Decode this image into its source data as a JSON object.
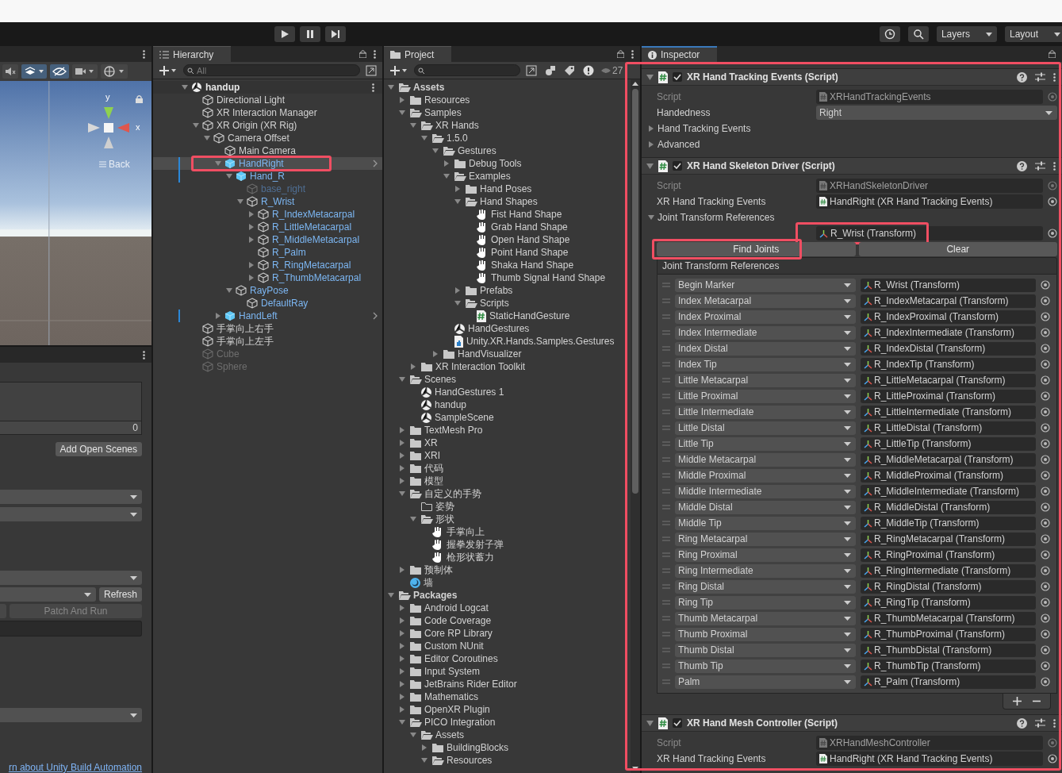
{
  "toolbar": {
    "layers": "Layers",
    "layout": "Layout"
  },
  "scene_view": {
    "y_label": "y",
    "x_label": "x",
    "back_label": "Back"
  },
  "build_panel": {
    "scene_count": "0",
    "add_button": "Add Open Scenes",
    "refresh_button": "Refresh",
    "patch_button": {
      "label": "Patch And Run",
      "disabled": true
    },
    "link": "rn about Unity Build Automation"
  },
  "hierarchy": {
    "title": "Hierarchy",
    "search_placeholder": "All",
    "items": [
      {
        "name": "handup",
        "kind": "scene",
        "selected": false,
        "expanded": true,
        "children": [
          {
            "name": "Directional Light",
            "kind": "object",
            "selected": false
          },
          {
            "name": "XR Interaction Manager",
            "kind": "object",
            "selected": false
          },
          {
            "name": "XR Origin (XR Rig)",
            "kind": "object",
            "selected": false,
            "expanded": true,
            "children": [
              {
                "name": "Camera Offset",
                "kind": "object",
                "selected": false,
                "expanded": true,
                "children": [
                  {
                    "name": "Main Camera",
                    "kind": "object",
                    "selected": false
                  },
                  {
                    "name": "HandRight",
                    "kind": "prefab_root",
                    "selected": true,
                    "highlighted": true,
                    "expanded": true,
                    "children": [
                      {
                        "name": "Hand_R",
                        "kind": "prefab_root",
                        "selected": false,
                        "expanded": true,
                        "children": [
                          {
                            "name": "base_right",
                            "kind": "inactive_prefab",
                            "selected": false
                          },
                          {
                            "name": "R_Wrist",
                            "kind": "prefab",
                            "selected": false,
                            "expanded": true,
                            "children": [
                              {
                                "name": "R_IndexMetacarpal",
                                "kind": "prefab",
                                "selected": false,
                                "expanded": false
                              },
                              {
                                "name": "R_LittleMetacarpal",
                                "kind": "prefab",
                                "selected": false,
                                "expanded": false
                              },
                              {
                                "name": "R_MiddleMetacarpal",
                                "kind": "prefab",
                                "selected": false,
                                "expanded": false
                              },
                              {
                                "name": "R_Palm",
                                "kind": "prefab",
                                "selected": false
                              },
                              {
                                "name": "R_RingMetacarpal",
                                "kind": "prefab",
                                "selected": false,
                                "expanded": false
                              },
                              {
                                "name": "R_ThumbMetacarpal",
                                "kind": "prefab",
                                "selected": false,
                                "expanded": false
                              }
                            ]
                          }
                        ]
                      },
                      {
                        "name": "RayPose",
                        "kind": "prefab",
                        "selected": false,
                        "expanded": true,
                        "children": [
                          {
                            "name": "DefaultRay",
                            "kind": "prefab",
                            "selected": false
                          }
                        ]
                      }
                    ]
                  },
                  {
                    "name": "HandLeft",
                    "kind": "prefab_root",
                    "selected": false,
                    "expanded": false
                  }
                ]
              }
            ]
          },
          {
            "name": "手掌向上右手",
            "kind": "object",
            "selected": false
          },
          {
            "name": "手掌向上左手",
            "kind": "object",
            "selected": false
          },
          {
            "name": "Cube",
            "kind": "inactive_object",
            "selected": false
          },
          {
            "name": "Sphere",
            "kind": "inactive_object",
            "selected": false
          }
        ]
      }
    ]
  },
  "project": {
    "title": "Project",
    "hidden_count": "27",
    "items": [
      {
        "name": "Assets",
        "kind": "root",
        "expanded": true,
        "children": [
          {
            "name": "Resources",
            "kind": "folder",
            "expanded": false
          },
          {
            "name": "Samples",
            "kind": "folder",
            "expanded": true,
            "children": [
              {
                "name": "XR Hands",
                "kind": "folder",
                "expanded": true,
                "children": [
                  {
                    "name": "1.5.0",
                    "kind": "folder",
                    "expanded": true,
                    "children": [
                      {
                        "name": "Gestures",
                        "kind": "folder",
                        "expanded": true,
                        "children": [
                          {
                            "name": "Debug Tools",
                            "kind": "folder",
                            "expanded": false
                          },
                          {
                            "name": "Examples",
                            "kind": "folder",
                            "expanded": true,
                            "children": [
                              {
                                "name": "Hand Poses",
                                "kind": "folder",
                                "expanded": false
                              },
                              {
                                "name": "Hand Shapes",
                                "kind": "folder",
                                "expanded": true,
                                "children": [
                                  {
                                    "name": "Fist Hand Shape",
                                    "kind": "hand_shape"
                                  },
                                  {
                                    "name": "Grab Hand Shape",
                                    "kind": "hand_shape"
                                  },
                                  {
                                    "name": "Open Hand Shape",
                                    "kind": "hand_shape"
                                  },
                                  {
                                    "name": "Point Hand Shape",
                                    "kind": "hand_shape"
                                  },
                                  {
                                    "name": "Shaka Hand Shape",
                                    "kind": "hand_shape"
                                  },
                                  {
                                    "name": "Thumb Signal Hand Shape",
                                    "kind": "hand_shape"
                                  }
                                ]
                              },
                              {
                                "name": "Prefabs",
                                "kind": "folder",
                                "expanded": false
                              },
                              {
                                "name": "Scripts",
                                "kind": "folder",
                                "expanded": true,
                                "children": [
                                  {
                                    "name": "StaticHandGesture",
                                    "kind": "script"
                                  }
                                ]
                              }
                            ]
                          },
                          {
                            "name": "HandGestures",
                            "kind": "scene"
                          },
                          {
                            "name": "Unity.XR.Hands.Samples.Gestures",
                            "kind": "assembly"
                          }
                        ]
                      },
                      {
                        "name": "HandVisualizer",
                        "kind": "folder",
                        "expanded": false
                      }
                    ]
                  }
                ]
              },
              {
                "name": "XR Interaction Toolkit",
                "kind": "folder",
                "expanded": false
              }
            ]
          },
          {
            "name": "Scenes",
            "kind": "folder",
            "expanded": true,
            "children": [
              {
                "name": "HandGestures 1",
                "kind": "scene"
              },
              {
                "name": "handup",
                "kind": "scene"
              },
              {
                "name": "SampleScene",
                "kind": "scene"
              }
            ]
          },
          {
            "name": "TextMesh Pro",
            "kind": "folder",
            "expanded": false
          },
          {
            "name": "XR",
            "kind": "folder",
            "expanded": false
          },
          {
            "name": "XRI",
            "kind": "folder",
            "expanded": false
          },
          {
            "name": "代码",
            "kind": "folder",
            "expanded": false
          },
          {
            "name": "模型",
            "kind": "folder",
            "expanded": false
          },
          {
            "name": "自定义的手势",
            "kind": "folder",
            "expanded": true,
            "children": [
              {
                "name": "姿势",
                "kind": "empty_folder"
              },
              {
                "name": "形状",
                "kind": "folder",
                "expanded": true,
                "children": [
                  {
                    "name": "手掌向上",
                    "kind": "hand_shape"
                  },
                  {
                    "name": "握拳发射子弹",
                    "kind": "hand_shape"
                  },
                  {
                    "name": "枪形状蓄力",
                    "kind": "hand_shape"
                  }
                ]
              }
            ]
          },
          {
            "name": "预制体",
            "kind": "folder",
            "expanded": false
          },
          {
            "name": "墙",
            "kind": "material"
          }
        ]
      },
      {
        "name": "Packages",
        "kind": "root",
        "expanded": true,
        "children": [
          {
            "name": "Android Logcat",
            "kind": "folder",
            "expanded": false
          },
          {
            "name": "Code Coverage",
            "kind": "folder",
            "expanded": false
          },
          {
            "name": "Core RP Library",
            "kind": "folder",
            "expanded": false
          },
          {
            "name": "Custom NUnit",
            "kind": "folder",
            "expanded": false
          },
          {
            "name": "Editor Coroutines",
            "kind": "folder",
            "expanded": false
          },
          {
            "name": "Input System",
            "kind": "folder",
            "expanded": false
          },
          {
            "name": "JetBrains Rider Editor",
            "kind": "folder",
            "expanded": false
          },
          {
            "name": "Mathematics",
            "kind": "folder",
            "expanded": false
          },
          {
            "name": "OpenXR Plugin",
            "kind": "folder",
            "expanded": false
          },
          {
            "name": "PICO Integration",
            "kind": "folder",
            "expanded": true,
            "children": [
              {
                "name": "Assets",
                "kind": "folder",
                "expanded": true,
                "children": [
                  {
                    "name": "BuildingBlocks",
                    "kind": "folder",
                    "expanded": false
                  },
                  {
                    "name": "Resources",
                    "kind": "folder",
                    "expanded": true
                  }
                ]
              }
            ]
          }
        ]
      }
    ]
  },
  "inspector": {
    "title": "Inspector",
    "highlighted": true,
    "components": [
      {
        "title": "XR Hand Tracking Events (Script)",
        "enabled": true,
        "expanded": true,
        "fields": [
          {
            "kind": "script",
            "label": "Script",
            "value": "XRHandTrackingEvents"
          },
          {
            "kind": "dropdown",
            "label": "Handedness",
            "value": "Right"
          },
          {
            "kind": "foldout",
            "label": "Hand Tracking Events",
            "expanded": false
          },
          {
            "kind": "foldout",
            "label": "Advanced",
            "expanded": false
          }
        ]
      },
      {
        "title": "XR Hand Skeleton Driver (Script)",
        "enabled": true,
        "expanded": true,
        "fields": [
          {
            "kind": "script",
            "label": "Script",
            "value": "XRHandSkeletonDriver"
          },
          {
            "kind": "object",
            "label": "XR Hand Tracking Events",
            "value": "HandRight (XR Hand Tracking Events)"
          },
          {
            "kind": "foldout",
            "label": "Joint Transform References",
            "expanded": true
          },
          {
            "kind": "transform",
            "value": "R_Wrist (Transform)",
            "highlighted": true
          },
          {
            "kind": "buttons",
            "buttons": [
              {
                "label": "Find Joints",
                "highlighted": true
              },
              {
                "label": "Clear"
              }
            ]
          },
          {
            "kind": "joint_list",
            "header": "Joint Transform References",
            "rows": [
              {
                "joint": "Begin Marker",
                "transform": "R_Wrist (Transform)"
              },
              {
                "joint": "Index Metacarpal",
                "transform": "R_IndexMetacarpal (Transform)"
              },
              {
                "joint": "Index Proximal",
                "transform": "R_IndexProximal (Transform)"
              },
              {
                "joint": "Index Intermediate",
                "transform": "R_IndexIntermediate (Transform)"
              },
              {
                "joint": "Index Distal",
                "transform": "R_IndexDistal (Transform)"
              },
              {
                "joint": "Index Tip",
                "transform": "R_IndexTip (Transform)"
              },
              {
                "joint": "Little Metacarpal",
                "transform": "R_LittleMetacarpal (Transform)"
              },
              {
                "joint": "Little Proximal",
                "transform": "R_LittleProximal (Transform)"
              },
              {
                "joint": "Little Intermediate",
                "transform": "R_LittleIntermediate (Transform)"
              },
              {
                "joint": "Little Distal",
                "transform": "R_LittleDistal (Transform)"
              },
              {
                "joint": "Little Tip",
                "transform": "R_LittleTip (Transform)"
              },
              {
                "joint": "Middle Metacarpal",
                "transform": "R_MiddleMetacarpal (Transform)"
              },
              {
                "joint": "Middle Proximal",
                "transform": "R_MiddleProximal (Transform)"
              },
              {
                "joint": "Middle Intermediate",
                "transform": "R_MiddleIntermediate (Transform)"
              },
              {
                "joint": "Middle Distal",
                "transform": "R_MiddleDistal (Transform)"
              },
              {
                "joint": "Middle Tip",
                "transform": "R_MiddleTip (Transform)"
              },
              {
                "joint": "Ring Metacarpal",
                "transform": "R_RingMetacarpal (Transform)"
              },
              {
                "joint": "Ring Proximal",
                "transform": "R_RingProximal (Transform)"
              },
              {
                "joint": "Ring Intermediate",
                "transform": "R_RingIntermediate (Transform)"
              },
              {
                "joint": "Ring Distal",
                "transform": "R_RingDistal (Transform)"
              },
              {
                "joint": "Ring Tip",
                "transform": "R_RingTip (Transform)"
              },
              {
                "joint": "Thumb Metacarpal",
                "transform": "R_ThumbMetacarpal (Transform)"
              },
              {
                "joint": "Thumb Proximal",
                "transform": "R_ThumbProximal (Transform)"
              },
              {
                "joint": "Thumb Distal",
                "transform": "R_ThumbDistal (Transform)"
              },
              {
                "joint": "Thumb Tip",
                "transform": "R_ThumbTip (Transform)"
              },
              {
                "joint": "Palm",
                "transform": "R_Palm (Transform)"
              }
            ]
          }
        ]
      },
      {
        "title": "XR Hand Mesh Controller (Script)",
        "enabled": true,
        "expanded": true,
        "fields": [
          {
            "kind": "script",
            "label": "Script",
            "value": "XRHandMeshController"
          },
          {
            "kind": "object",
            "label": "XR Hand Tracking Events",
            "value": "HandRight (XR Hand Tracking Events)"
          }
        ]
      }
    ]
  }
}
